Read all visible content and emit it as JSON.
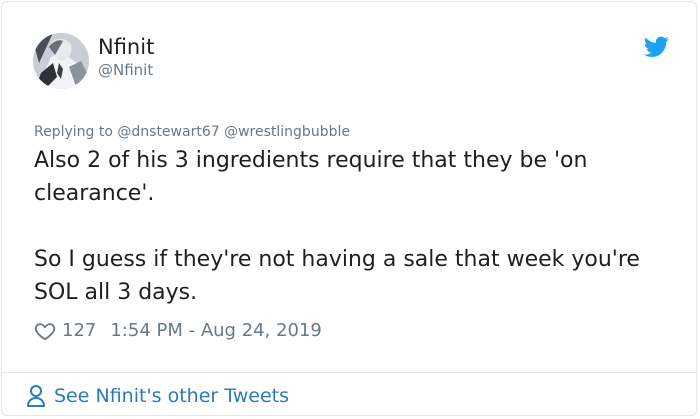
{
  "author": {
    "display_name": "Nfinit",
    "handle": "@Nfinit"
  },
  "reply": {
    "prefix": "Replying to",
    "mentions": [
      "@dnstewart67",
      "@wrestlingbubble"
    ]
  },
  "tweet": {
    "text": "Also 2 of his 3 ingredients require that they be 'on clearance'.\n\nSo I guess if they're not having a sale that week you're SOL all 3 days."
  },
  "meta": {
    "likes": "127",
    "timestamp": "1:54 PM - Aug 24, 2019"
  },
  "footer": {
    "link_label": "See Nfinit's other Tweets"
  },
  "icons": {
    "brand": "twitter-bird-icon",
    "like": "heart-icon",
    "profile": "user-icon"
  },
  "colors": {
    "twitter_blue": "#1da1f2",
    "link_blue": "#2b7bb9",
    "secondary_text": "#697882",
    "border": "#e1e8ed"
  }
}
